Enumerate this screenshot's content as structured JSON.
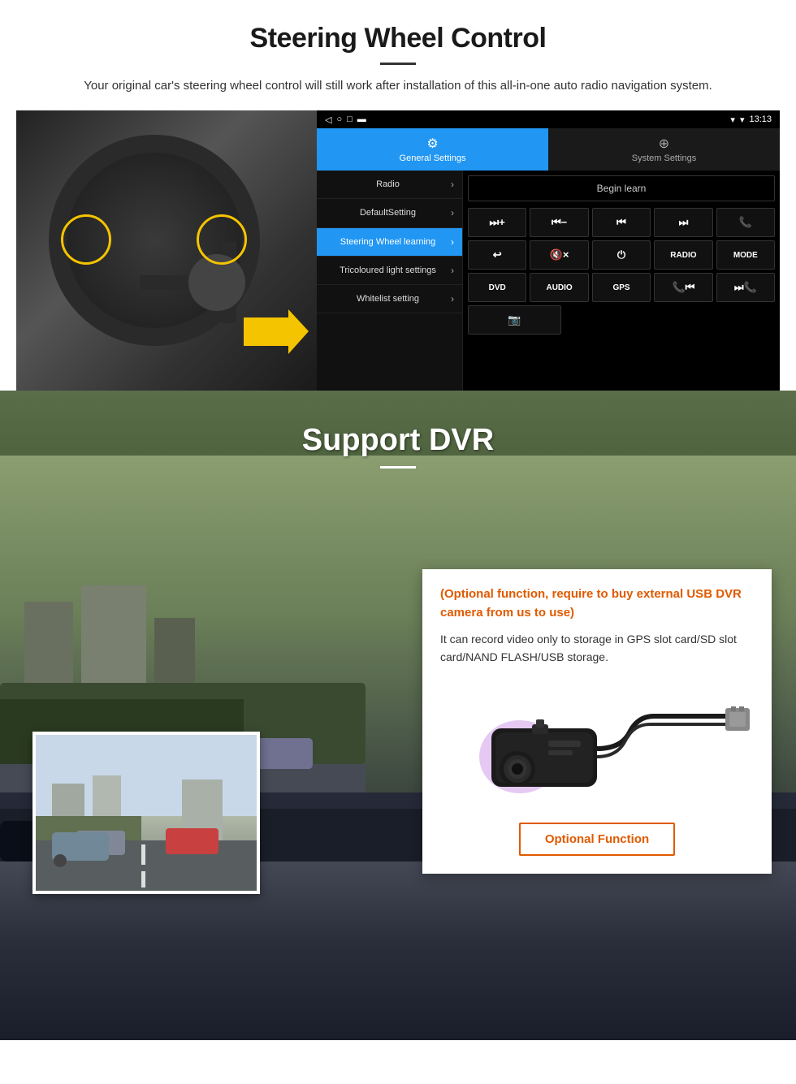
{
  "steering_section": {
    "title": "Steering Wheel Control",
    "subtitle": "Your original car's steering wheel control will still work after installation of this all-in-one auto radio navigation system."
  },
  "android_ui": {
    "status_bar": {
      "time": "13:13",
      "signal_icon": "▼",
      "wifi_icon": "▾"
    },
    "nav_icons": [
      "◁",
      "○",
      "□",
      "▬"
    ],
    "tabs": [
      {
        "id": "general",
        "icon": "⚙",
        "label": "General Settings",
        "active": true
      },
      {
        "id": "system",
        "icon": "⊕",
        "label": "System Settings",
        "active": false
      }
    ],
    "menu_items": [
      {
        "label": "Radio",
        "active": false
      },
      {
        "label": "DefaultSetting",
        "active": false
      },
      {
        "label": "Steering Wheel learning",
        "active": true
      },
      {
        "label": "Tricoloured light settings",
        "active": false
      },
      {
        "label": "Whitelist setting",
        "active": false
      }
    ],
    "begin_learn": "Begin learn",
    "control_buttons": {
      "row1": [
        "⏭+",
        "⏮-",
        "⏮⏮",
        "⏭⏭",
        "📞"
      ],
      "row2": [
        "↩",
        "🔇×",
        "⏻",
        "RADIO",
        "MODE"
      ],
      "row3": [
        "DVD",
        "AUDIO",
        "GPS",
        "📞⏮",
        "⏭📞"
      ],
      "row4": [
        "📷"
      ]
    }
  },
  "dvr_section": {
    "title": "Support DVR",
    "optional_text": "(Optional function, require to buy external USB DVR camera from us to use)",
    "desc_text": "It can record video only to storage in GPS slot card/SD slot card/NAND FLASH/USB storage.",
    "optional_button": "Optional Function"
  }
}
